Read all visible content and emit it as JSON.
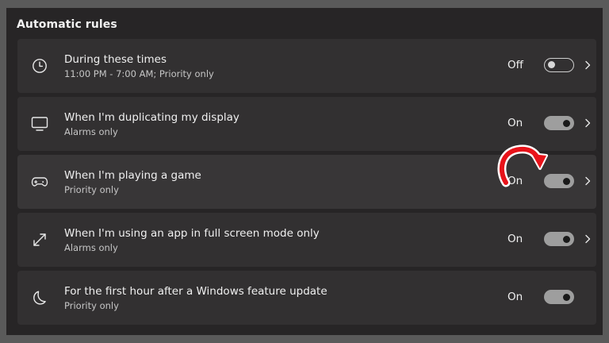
{
  "section": {
    "title": "Automatic rules"
  },
  "rules": [
    {
      "icon": "clock-icon",
      "title": "During these times",
      "subtitle": "11:00 PM - 7:00 AM; Priority only",
      "state_label": "Off",
      "toggle_on": false,
      "has_chevron": true
    },
    {
      "icon": "monitor-icon",
      "title": "When I'm duplicating my display",
      "subtitle": "Alarms only",
      "state_label": "On",
      "toggle_on": true,
      "has_chevron": true
    },
    {
      "icon": "gamepad-icon",
      "title": "When I'm playing a game",
      "subtitle": "Priority only",
      "state_label": "On",
      "toggle_on": true,
      "has_chevron": true
    },
    {
      "icon": "fullscreen-arrows-icon",
      "title": "When I'm using an app in full screen mode only",
      "subtitle": "Alarms only",
      "state_label": "On",
      "toggle_on": true,
      "has_chevron": true
    },
    {
      "icon": "moon-icon",
      "title": "For the first hour after a Windows feature update",
      "subtitle": "Priority only",
      "state_label": "On",
      "toggle_on": true,
      "has_chevron": false
    }
  ],
  "annotation": {
    "icon": "red-curved-arrow-icon",
    "color": "#e8131a"
  },
  "colors": {
    "panel_bg": "#272526",
    "card_bg": "#323031",
    "toggle_on_track": "#9e9e9e",
    "outer_bg": "#5a5a5a"
  }
}
